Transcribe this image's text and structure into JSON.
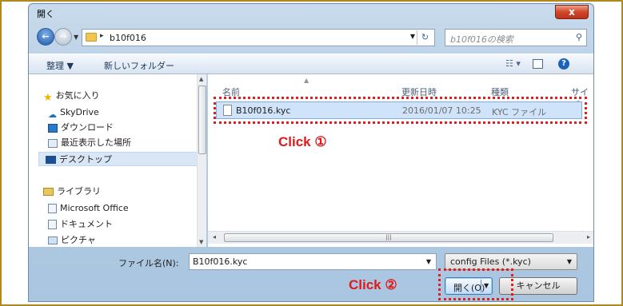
{
  "window": {
    "title": "開く",
    "close_glyph": "x"
  },
  "nav": {
    "address": "b10f016",
    "search_placeholder": "b10f016の検索"
  },
  "toolbar": {
    "organize": "整理 ▼",
    "new_folder": "新しいフォルダー",
    "views": "☷ ▾",
    "help": "?"
  },
  "sidebar": {
    "items": [
      {
        "label": "お気に入り",
        "icon": "star-icon",
        "color": "#f0b400"
      },
      {
        "label": "SkyDrive",
        "icon": "cloud-icon",
        "color": "#1a6fc4"
      },
      {
        "label": "ダウンロード",
        "icon": "download-folder-icon",
        "color": "#2a79c8"
      },
      {
        "label": "最近表示した場所",
        "icon": "recent-places-icon",
        "color": "#6a8ab0"
      },
      {
        "label": "デスクトップ",
        "icon": "desktop-icon",
        "color": "#1c4f8f"
      },
      {
        "label": "ライブラリ",
        "icon": "library-icon",
        "color": "#c69a2a"
      },
      {
        "label": "Microsoft Office",
        "icon": "office-library-icon",
        "color": "#6a8ab0"
      },
      {
        "label": "ドキュメント",
        "icon": "documents-icon",
        "color": "#6a8ab0"
      },
      {
        "label": "ピクチャ",
        "icon": "pictures-icon",
        "color": "#6a8ab0"
      }
    ]
  },
  "files": {
    "columns": [
      "名前",
      "更新日時",
      "種類",
      "サイズ"
    ],
    "rows": [
      {
        "name": "B10f016.kyc",
        "modified": "2016/01/07 10:25",
        "type": "KYC ファイル"
      }
    ]
  },
  "bottom": {
    "filename_label": "ファイル名(N):",
    "filename_value": "B10f016.kyc",
    "filetype_value": "config Files (*.kyc)",
    "open_label": "開く(O)",
    "cancel_label": "キャンセル"
  },
  "annotations": {
    "callout1": "Click ①",
    "callout2": "Click ②",
    "color": "#e02020"
  }
}
